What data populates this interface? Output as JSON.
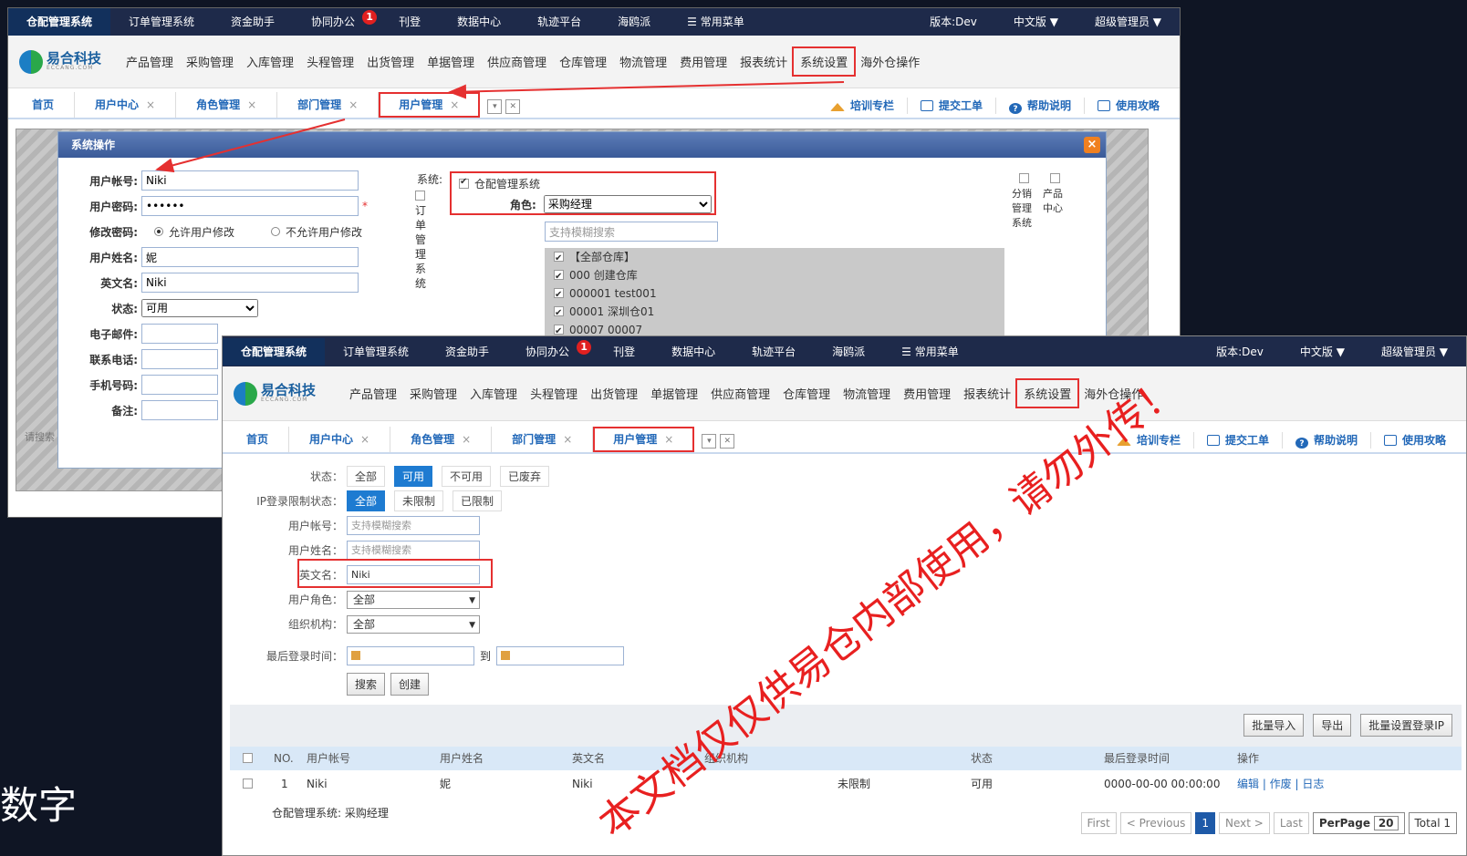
{
  "bg_caption": "数字",
  "topbar": {
    "items": [
      "仓配管理系统",
      "订单管理系统",
      "资金助手",
      "协同办公",
      "刊登",
      "数据中心",
      "轨迹平台",
      "海鸥派",
      "☰ 常用菜单"
    ],
    "badge": "1",
    "version": "版本:Dev",
    "lang": "中文版 ▼",
    "user": "超级管理员 ▼"
  },
  "logo": {
    "name": "易合科技",
    "sub": "ECCANG.COM"
  },
  "menu": [
    "产品管理",
    "采购管理",
    "入库管理",
    "头程管理",
    "出货管理",
    "单据管理",
    "供应商管理",
    "仓库管理",
    "物流管理",
    "费用管理",
    "报表统计",
    "系统设置",
    "海外仓操作"
  ],
  "tabs": [
    "首页",
    "用户中心",
    "角色管理",
    "部门管理",
    "用户管理"
  ],
  "tab_close": "×",
  "helpers": {
    "training": "培训专栏",
    "ticket": "提交工单",
    "help": "帮助说明",
    "guide": "使用攻略"
  },
  "dialog": {
    "title": "系统操作",
    "close": "×",
    "account_label": "用户帐号:",
    "account": "Niki",
    "password_label": "用户密码:",
    "password": "••••••",
    "modify_label": "修改密码:",
    "allow": "允许用户修改",
    "disallow": "不允许用户修改",
    "name_label": "用户姓名:",
    "name": "妮",
    "en_label": "英文名:",
    "en": "Niki",
    "status_label": "状态:",
    "status": "可用",
    "email_label": "电子邮件:",
    "phone_label": "联系电话:",
    "mobile_label": "手机号码:",
    "note_label": "备注:",
    "sys_label": "系统:",
    "sys_wms": "仓配管理系统",
    "sys_oms": "订单管理系统",
    "role_label": "角色:",
    "role": "采购经理",
    "search_placeholder": "支持模糊搜索",
    "warehouses": [
      "【全部仓库】",
      "000 创建仓库",
      "000001 test001",
      "00001 深圳仓01",
      "00007 00007"
    ],
    "dist": "分销管理系统",
    "pcenter": "产品中心",
    "side_left": "请搜索"
  },
  "list": {
    "status_label": "状态：",
    "status_opts": [
      "全部",
      "可用",
      "不可用",
      "已废弃"
    ],
    "ip_label": "IP登录限制状态：",
    "ip_opts": [
      "全部",
      "未限制",
      "已限制"
    ],
    "account_label": "用户帐号：",
    "name_label": "用户姓名：",
    "placeholder": "支持模糊搜索",
    "en_label": "英文名：",
    "en_value": "Niki",
    "role_label": "用户角色：",
    "role_value": "全部",
    "org_label": "组织机构：",
    "org_value": "全部",
    "last_login_label": "最后登录时间：",
    "to": "到",
    "search_btn": "搜索",
    "create_btn": "创建",
    "import_btn": "批量导入",
    "export_btn": "导出",
    "setip_btn": "批量设置登录IP",
    "columns": [
      "NO.",
      "用户帐号",
      "用户姓名",
      "英文名",
      "组织机构",
      "",
      "状态",
      "最后登录时间",
      "操作"
    ],
    "row": {
      "no": "1",
      "account": "Niki",
      "name": "妮",
      "en": "Niki",
      "org": "",
      "ip": "未限制",
      "status": "可用",
      "last": "0000-00-00 00:00:00",
      "ops": "编辑 | 作废 | 日志"
    },
    "role_note": "仓配管理系统: 采购经理",
    "pager": {
      "first": "First",
      "prev": "< Previous",
      "page": "1",
      "next": "Next >",
      "last": "Last",
      "perpage": "PerPage",
      "size": "20",
      "total": "Total 1"
    }
  },
  "watermark": "本文档仅仅供易仓内部使用，请勿外传！",
  "colors": {
    "accent": "#1e7bd1",
    "highlight": "#e53030",
    "topbar": "#1e2a4a"
  }
}
